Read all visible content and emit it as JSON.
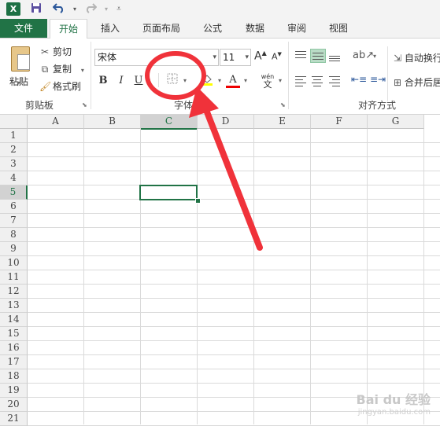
{
  "qat": {
    "app_icon": "X",
    "save_icon": "save-icon",
    "undo_icon": "undo-icon",
    "redo_icon": "redo-icon",
    "customize_icon": "customize-icon"
  },
  "tabs": {
    "file": "文件",
    "home": "开始",
    "insert": "插入",
    "page_layout": "页面布局",
    "formulas": "公式",
    "data": "数据",
    "review": "审阅",
    "view": "视图"
  },
  "clipboard": {
    "paste": "粘贴",
    "cut": "剪切",
    "copy": "复制",
    "format_painter": "格式刷",
    "group_label": "剪贴板"
  },
  "font": {
    "name": "宋体",
    "size": "11",
    "bold": "B",
    "italic": "I",
    "underline": "U",
    "grow": "A",
    "shrink": "A",
    "font_color": "A",
    "wen": "wén",
    "wen_char": "文",
    "group_label": "字体"
  },
  "alignment": {
    "wrap_text": "自动换行",
    "merge_center": "合并后居中",
    "group_label": "对齐方式"
  },
  "columns": [
    "A",
    "B",
    "C",
    "D",
    "E",
    "F",
    "G"
  ],
  "rows": [
    "1",
    "2",
    "3",
    "4",
    "5",
    "6",
    "7",
    "8",
    "9",
    "10",
    "11",
    "12",
    "13",
    "14",
    "15",
    "16",
    "17",
    "18",
    "19",
    "20",
    "21"
  ],
  "active_cell": "C5",
  "colors": {
    "accent": "#217346",
    "annotation": "#f0323a"
  },
  "watermark": {
    "text": "Bai du 经验",
    "sub": "jingyan.baidu.com"
  }
}
